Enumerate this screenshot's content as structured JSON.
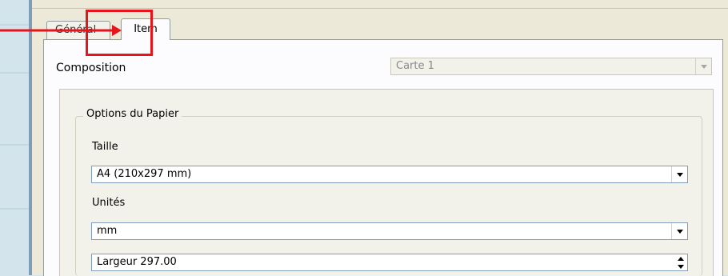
{
  "tabs": {
    "general": "Général",
    "item": "Item"
  },
  "composition": {
    "label": "Composition",
    "value": "Carte 1"
  },
  "paper_options": {
    "title": "Options du Papier",
    "size_label": "Taille",
    "size_value": "A4 (210x297 mm)",
    "units_label": "Unités",
    "units_value": "mm",
    "width_value": "Largeur 297.00"
  },
  "annotation": {
    "color": "#e8141c"
  }
}
